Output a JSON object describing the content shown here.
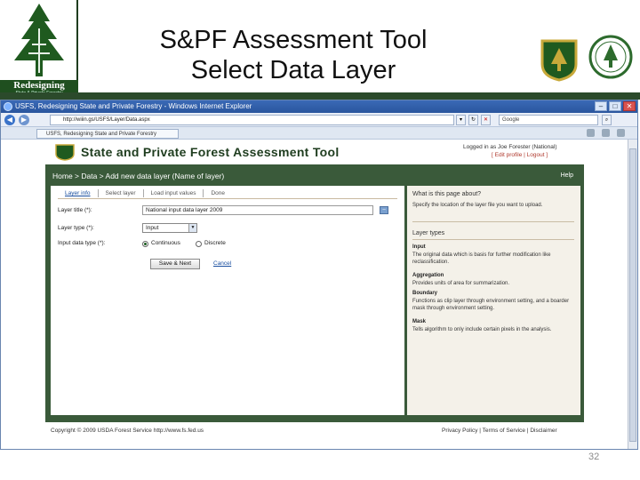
{
  "slide": {
    "title_line1": "S&PF Assessment Tool",
    "title_line2": "Select Data Layer",
    "logo_text": "Redesigning",
    "logo_subtext": "State & Private Forestry",
    "page_number": "32"
  },
  "browser": {
    "window_title": "USFS, Redesigning State and Private Forestry - Windows Internet Explorer",
    "address": "http://wiiin.gs/USFS/Layer/Data.aspx",
    "search_placeholder": "Google",
    "tab_label": "USFS, Redesigning State and Private Forestry"
  },
  "app": {
    "title": "State and Private Forest Assessment Tool",
    "login_info": "Logged in as Joe Forester (National)",
    "login_links": "[ Edit profile | Logout ]",
    "breadcrumb": "Home > Data > Add new data layer (Name of layer)",
    "help_link": "Help",
    "wizard_tabs": [
      "Layer info",
      "Select layer",
      "Load input values",
      "Done"
    ],
    "form": {
      "layer_title_label": "Layer title (*):",
      "layer_title_value": "National input data layer 2009",
      "layer_type_label": "Layer type (*):",
      "layer_type_value": "Input",
      "input_data_type_label": "Input data type (*):",
      "radio_continuous": "Continuous",
      "radio_discrete": "Discrete",
      "submit_label": "Save & Next",
      "cancel_label": "Cancel"
    },
    "help": {
      "question": "What is this page about?",
      "question_text": "Specify the location of the layer file you want to upload.",
      "layer_types_heading": "Layer types",
      "terms": [
        {
          "term": "Input",
          "text": "The original data which is basis for further modification like reclassification."
        },
        {
          "term": "Aggregation",
          "text": "Provides units of area for summarization."
        },
        {
          "term": "Boundary",
          "text": "Functions as clip layer through environment setting, and a boarder mask through environment setting."
        },
        {
          "term": "Mask",
          "text": "Tells algorithm to only include certain pixels in the analysis."
        }
      ]
    },
    "footer_left": "Copyright © 2009 USDA Forest Service http://www.fs.fed.us",
    "footer_right": "Privacy Policy | Terms of Service | Disclaimer"
  }
}
